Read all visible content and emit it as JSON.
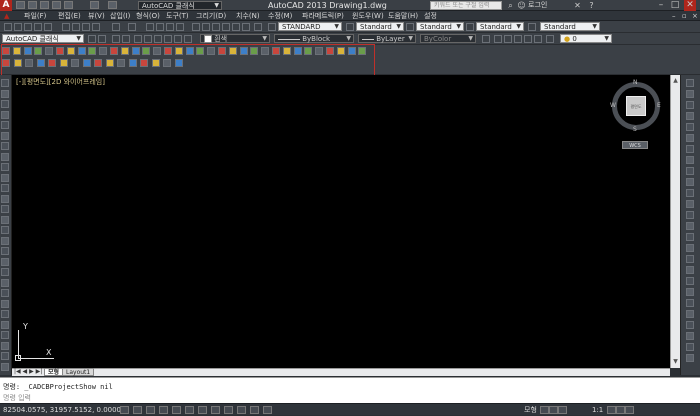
{
  "titlebar": {
    "workspace": "AutoCAD 클래식",
    "app_title": "AutoCAD 2013    Drawing1.dwg",
    "search_placeholder": "키워드 또는 구절 입력",
    "login": "로그인"
  },
  "menubar": {
    "items": [
      "파일(F)",
      "편집(E)",
      "뷰(V)",
      "삽입(I)",
      "형식(O)",
      "도구(T)",
      "그리기(D)",
      "치수(N)",
      "수정(M)",
      "파라메트릭(P)",
      "윈도우(W)",
      "도움말(H)",
      "설정"
    ]
  },
  "toolbar2": {
    "text_style": "STANDARD",
    "dim_style": "Standard",
    "table_style": "Standard",
    "mleader_style": "Standard"
  },
  "toolbar3": {
    "workspace": "AutoCAD 클래식",
    "color_name": "흰색",
    "linetype": "ByBlock",
    "lineweight": "ByLayer",
    "plot_style": "ByColor",
    "layer_value": "0"
  },
  "drawing": {
    "viewport_label": "[-][평면도][2D 와이어프레임]",
    "wcs_label": "WCS",
    "viewcube_top": "평면도",
    "viewcube_n": "N",
    "viewcube_s": "S",
    "viewcube_e": "E",
    "viewcube_w": "W",
    "ucs_x": "X",
    "ucs_y": "Y"
  },
  "tabs": [
    "모형",
    "Layout1"
  ],
  "command": {
    "history": "명령: _CADCBProjectShow nil",
    "prompt": "명령 입력"
  },
  "status": {
    "coords": "82504.0575, 31957.5152, 0.0000",
    "model": "모형",
    "scale": "1:1"
  },
  "colors": {
    "accent": "#b0261c",
    "canvas": "#000000",
    "panel": "#3b4046",
    "highlight_box": "#c0302a"
  }
}
